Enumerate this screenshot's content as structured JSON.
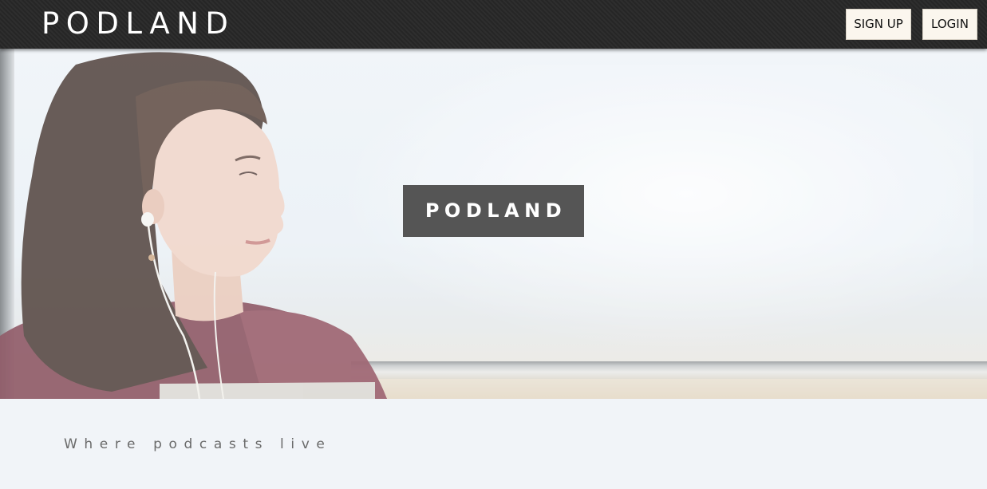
{
  "header": {
    "brand": "PODLAND",
    "signup_label": "SIGN UP",
    "login_label": "LOGIN"
  },
  "hero": {
    "title": "PODLAND"
  },
  "tagline": {
    "text": "Where podcasts live"
  },
  "colors": {
    "topbar": "#262626",
    "button_bg": "#fbf6ee",
    "hero_title_bg": "#555555",
    "page_bg": "#f1f4f8",
    "tagline_text": "#6a6a6a"
  }
}
